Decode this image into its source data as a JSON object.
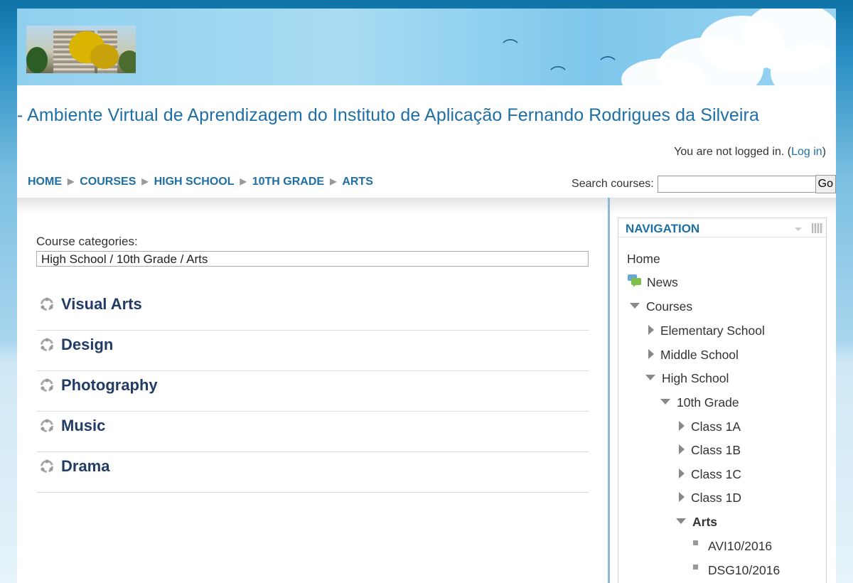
{
  "site_title": "- Ambiente Virtual de Aprendizagem do Instituto de Aplicação Fernando Rodrigues da Silveira",
  "login": {
    "text": "You are not logged in. (",
    "link": "Log in",
    "suffix": ")"
  },
  "breadcrumb": [
    "HOME",
    "COURSES",
    "HIGH SCHOOL",
    "10TH GRADE",
    "ARTS"
  ],
  "search": {
    "label": "Search courses:",
    "value": "",
    "button": "Go"
  },
  "course_categories": {
    "label": "Course categories:",
    "selected": "High School / 10th Grade / Arts"
  },
  "categories": [
    "Visual Arts",
    "Design",
    "Photography",
    "Music",
    "Drama"
  ],
  "navigation": {
    "title": "NAVIGATION",
    "items": [
      {
        "label": "Home",
        "icon": "none"
      },
      {
        "label": "News",
        "icon": "forum-icon"
      },
      {
        "label": "Courses",
        "icon": "expanded"
      },
      {
        "label": "Elementary School",
        "icon": "collapsed"
      },
      {
        "label": "Middle School",
        "icon": "collapsed"
      },
      {
        "label": "High School",
        "icon": "expanded"
      },
      {
        "label": "10th Grade",
        "icon": "expanded"
      },
      {
        "label": "Class 1A",
        "icon": "collapsed"
      },
      {
        "label": "Class 1B",
        "icon": "collapsed"
      },
      {
        "label": "Class 1C",
        "icon": "collapsed"
      },
      {
        "label": "Class 1D",
        "icon": "collapsed"
      },
      {
        "label": "Arts",
        "icon": "expanded",
        "bold": true
      },
      {
        "label": "AVI10/2016",
        "icon": "course"
      },
      {
        "label": "DSG10/2016",
        "icon": "course"
      }
    ]
  },
  "colors": {
    "link": "#1d6fa5",
    "category_title": "#223c66",
    "header_blue": "#0e72a6"
  }
}
